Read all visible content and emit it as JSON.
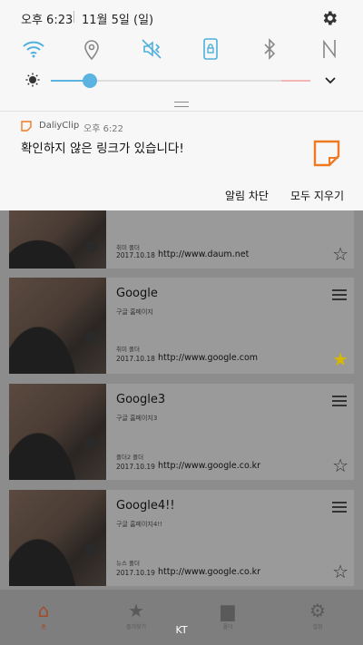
{
  "status_bar": {
    "time": "오후 6:23",
    "date": "11월 5일 (일)"
  },
  "quick_settings": [
    {
      "icon": "wifi-icon"
    },
    {
      "icon": "location-icon"
    },
    {
      "icon": "mute-vibrate-icon"
    },
    {
      "icon": "screen-rotation-lock-icon"
    },
    {
      "icon": "bluetooth-icon"
    },
    {
      "icon": "nfc-icon"
    }
  ],
  "brightness": {
    "level": 0.15
  },
  "notification": {
    "app": "DaliyClip",
    "time": "오후 6:22",
    "message": "확인하지 않은 링크가 있습니다!",
    "actions": {
      "block": "알림 차단",
      "clear_all": "모두 지우기"
    },
    "accent": "#f07a24"
  },
  "clips": [
    {
      "title": "",
      "desc": "",
      "folder": "취미 폴더",
      "date": "2017.10.18",
      "url": "http://www.daum.net",
      "starred": false
    },
    {
      "title": "Google",
      "desc": "구글 홈페이지",
      "folder": "취미 폴더",
      "date": "2017.10.18",
      "url": "http://www.google.com",
      "starred": true
    },
    {
      "title": "Google3",
      "desc": "구글 홈페이지3",
      "folder": "폴더2 폴더",
      "date": "2017.10.19",
      "url": "http://www.google.co.kr",
      "starred": false
    },
    {
      "title": "Google4!!",
      "desc": "구글 홈페이지4!!",
      "folder": "뉴스 폴더",
      "date": "2017.10.19",
      "url": "http://www.google.co.kr",
      "starred": false
    }
  ],
  "bottom_nav": [
    {
      "label": "홈",
      "icon": "home-icon",
      "active": true
    },
    {
      "label": "즐겨찾기",
      "icon": "star-icon",
      "active": false
    },
    {
      "label": "폴더",
      "icon": "folder-icon",
      "active": false
    },
    {
      "label": "설정",
      "icon": "gear-icon",
      "active": false
    }
  ],
  "carrier": "KT"
}
